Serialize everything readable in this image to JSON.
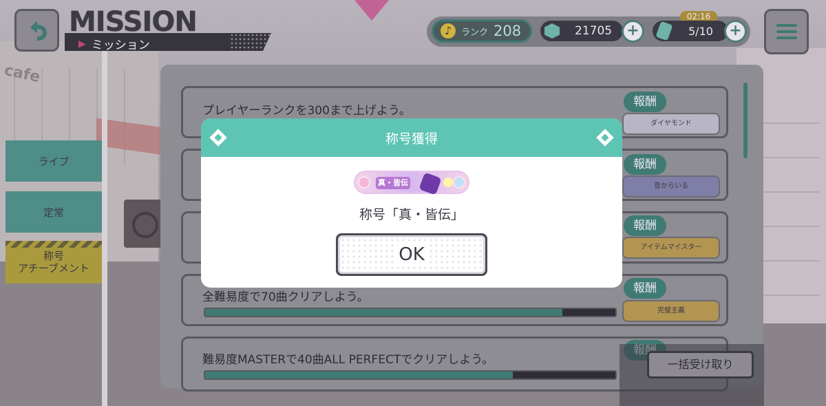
{
  "header": {
    "title": "MISSION",
    "subtitle": "ミッション"
  },
  "status": {
    "rank_label": "ランク",
    "rank_value": "208",
    "gems": "21705",
    "energy": "5/10",
    "timer": "02:16"
  },
  "tabs": [
    {
      "label": "ライブ"
    },
    {
      "label": "定常"
    },
    {
      "label_line1": "称号",
      "label_line2": "アチーブメント"
    }
  ],
  "missions": [
    {
      "text": "プレイヤーランクを300まで上げよう。",
      "reward_label": "報酬",
      "reward_item": "ダイヤモンド"
    },
    {
      "text": "",
      "reward_label": "報酬",
      "reward_item": "音からいる"
    },
    {
      "text": "",
      "reward_label": "報酬",
      "reward_item": "アイテムマイスター"
    },
    {
      "text": "全難易度で70曲クリアしよう。",
      "reward_label": "報酬",
      "reward_item": "完璧主義",
      "progress": 0.87
    },
    {
      "text": "難易度MASTERで40曲ALL PERFECTでクリアしよう。",
      "reward_label": "報酬",
      "progress": 0.75
    }
  ],
  "collect_all": "一括受け取り",
  "modal": {
    "header": "称号獲得",
    "badge_text": "真・皆伝",
    "title_name": "称号「真・皆伝」",
    "ok": "OK"
  },
  "colors": {
    "accent": "#5ec4b4",
    "modal_bg": "#ffffff"
  }
}
